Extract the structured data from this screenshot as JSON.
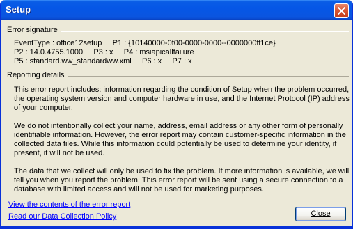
{
  "window": {
    "title": "Setup",
    "close_icon": "close-icon"
  },
  "error_signature": {
    "heading": "Error signature",
    "lines": [
      "EventType : office12setup     P1 : {10140000-0f00-0000-0000--0000000ff1ce}",
      "P2 : 14.0.4755.1000     P3 : x     P4 : msiapicallfailure",
      "P5 : standard.ww_standardww.xml     P6 : x     P7 : x"
    ]
  },
  "reporting_details": {
    "heading": "Reporting details",
    "paragraphs": [
      "This error report includes: information regarding the condition of Setup when the problem occurred, the operating system version and computer hardware in use, and the Internet Protocol (IP) address of your computer.",
      "We do not intentionally collect your name, address, email address or any other form of personally identifiable information. However, the error report may contain customer-specific information in the collected data files. While this information could potentially be used to determine your identity, if present, it will not be used.",
      "The data that we collect will only be used to fix the problem. If more information is available, we will tell you when you report the problem. This error report will be sent using a secure connection to a database with limited access and will not be used for marketing purposes."
    ]
  },
  "links": {
    "view_contents": "View the contents of the error report",
    "data_policy": "Read our Data Collection Policy"
  },
  "buttons": {
    "close": "Close"
  },
  "colors": {
    "titlebar": "#0556e6",
    "dialog_bg": "#ece9d8",
    "link": "#0000ff"
  }
}
